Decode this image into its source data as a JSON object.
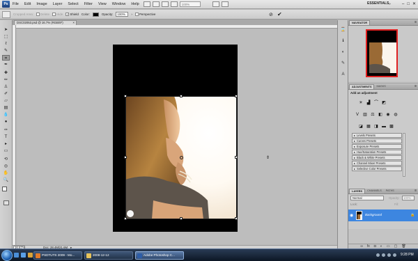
{
  "app": {
    "logo": "Ps",
    "workspace": "ESSENTIALS",
    "zoom_select": "100%"
  },
  "menu": [
    "File",
    "Edit",
    "Image",
    "Layer",
    "Select",
    "Filter",
    "View",
    "Window",
    "Help"
  ],
  "window_buttons": [
    "–",
    "□",
    "✕"
  ],
  "options": {
    "cropped_area": "Cropped Area:",
    "delete": "Delete",
    "hide": "Hide",
    "shield": "Shield",
    "color": "Color:",
    "opacity_label": "Opacity:",
    "opacity_value": "100%",
    "perspective": "Perspective",
    "cancel": "⊘",
    "commit": "✔"
  },
  "document": {
    "tab_title": "DSC02053.psd @ 16.7% (RGB/8*)",
    "close": "×"
  },
  "status": {
    "zoom": "16.67%",
    "doc_info": "Doc: 28.4M/21.6M",
    "arrow": "▸"
  },
  "canvas_cursor": "⇕",
  "navigator": {
    "tab_active": "NAVIGATOR"
  },
  "adjustments": {
    "tab_active": "ADJUSTMENTS",
    "tab_other": "MASKS",
    "title": "Add an adjustment",
    "presets": [
      "Levels Presets",
      "Curves Presets",
      "Exposure Presets",
      "Hue/Saturation Presets",
      "Black & White Presets",
      "Channel Mixer Presets",
      "Selective Color Presets"
    ]
  },
  "layers": {
    "tabs": [
      "LAYERS",
      "CHANNELS",
      "PATHS"
    ],
    "blend_mode": "Normal",
    "opacity_label": "Opacity:",
    "opacity_value": "100%",
    "lock_label": "Lock:",
    "fill_label": "Fill:",
    "layer_name": "Background"
  },
  "taskbar": {
    "buttons": [
      "PSDTUTS 2009 - Mo...",
      "2008-12-12",
      "Adobe Photoshop C..."
    ],
    "clock": "9:28 PM"
  },
  "colors": {
    "layer_selected": "#3d86e0",
    "nav_view_box": "#e02020",
    "taskbar": "#0c1624"
  }
}
